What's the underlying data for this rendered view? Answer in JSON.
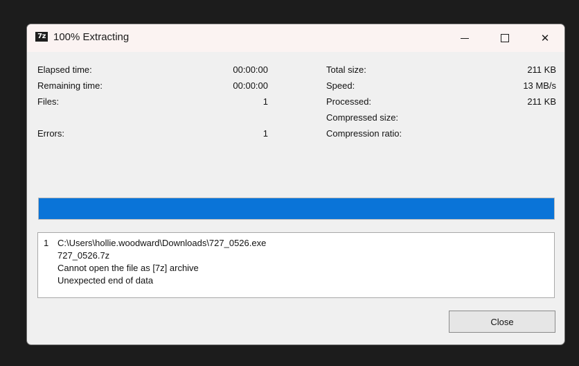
{
  "window": {
    "title": "100% Extracting",
    "app_icon_label": "7z",
    "controls": {
      "minimize_icon": "minimize-icon",
      "maximize_icon": "maximize-icon",
      "close_glyph": "✕"
    }
  },
  "stats_left": [
    {
      "label": "Elapsed time:",
      "value": "00:00:00"
    },
    {
      "label": "Remaining time:",
      "value": "00:00:00"
    },
    {
      "label": "Files:",
      "value": "1"
    },
    {
      "label": "Errors:",
      "value": "1"
    }
  ],
  "stats_right": [
    {
      "label": "Total size:",
      "value": "211 KB"
    },
    {
      "label": "Speed:",
      "value": "13 MB/s"
    },
    {
      "label": "Processed:",
      "value": "211 KB"
    },
    {
      "label": "Compressed size:",
      "value": ""
    },
    {
      "label": "Compression ratio:",
      "value": ""
    }
  ],
  "progress": {
    "percent": 100,
    "color": "#0a74d8"
  },
  "log": {
    "entries": [
      {
        "index": "1",
        "lines": [
          "C:\\Users\\hollie.woodward\\Downloads\\727_0526.exe",
          "727_0526.7z",
          "Cannot open the file as [7z] archive",
          "Unexpected end of data"
        ]
      }
    ]
  },
  "buttons": {
    "close_label": "Close"
  }
}
